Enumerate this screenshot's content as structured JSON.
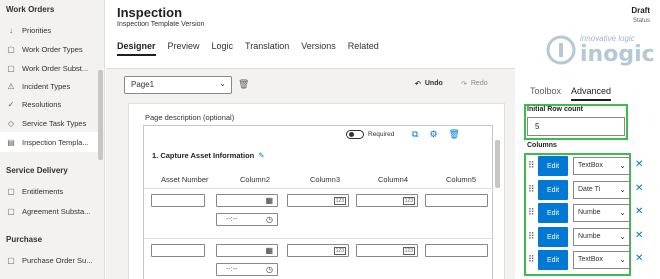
{
  "sidebar": {
    "groups": [
      {
        "label": "Work Orders"
      },
      {
        "label": "Service Delivery"
      },
      {
        "label": "Purchase"
      }
    ],
    "items": [
      {
        "label": "Priorities",
        "icon": "sort-icon"
      },
      {
        "label": "Work Order Types",
        "icon": "doc-icon"
      },
      {
        "label": "Work Order Subst...",
        "icon": "doc-icon"
      },
      {
        "label": "Incident Types",
        "icon": "warning-icon"
      },
      {
        "label": "Resolutions",
        "icon": "check-circle-icon"
      },
      {
        "label": "Service Task Types",
        "icon": "tag-icon"
      },
      {
        "label": "Inspection Templa...",
        "icon": "clipboard-icon"
      },
      {
        "label": "Entitlements",
        "icon": "doc-icon"
      },
      {
        "label": "Agreement Substa...",
        "icon": "doc-icon"
      },
      {
        "label": "Purchase Order Su...",
        "icon": "doc-icon"
      }
    ]
  },
  "header": {
    "title": "Inspection",
    "subtitle": "Inspection Template Version",
    "status_value": "Draft",
    "status_label": "Status",
    "tabs": [
      "Designer",
      "Preview",
      "Logic",
      "Translation",
      "Versions",
      "Related"
    ]
  },
  "logo": {
    "tagline": "innovative logic",
    "brand": "inogic"
  },
  "toolbar": {
    "page_select": "Page1",
    "undo": "Undo",
    "redo": "Redo"
  },
  "canvas": {
    "page_description": "Page description (optional)",
    "required_label": "Required",
    "question_title": "1. Capture Asset Information",
    "columns": [
      "Asset Number",
      "Column2",
      "Column3",
      "Column4",
      "Column5"
    ],
    "time_placeholder": "--:--"
  },
  "right_panel": {
    "tabs": [
      "Toolbox",
      "Advanced"
    ],
    "initial_row_count_label": "Initial Row count",
    "initial_row_count_value": "5",
    "columns_label": "Columns",
    "edit_label": "Edit",
    "column_types": [
      "TextBox",
      "Date Ti",
      "Numbe",
      "Numbe",
      "TextBox"
    ]
  },
  "colors": {
    "accent": "#0078d4",
    "highlight": "#3dbb4c"
  }
}
